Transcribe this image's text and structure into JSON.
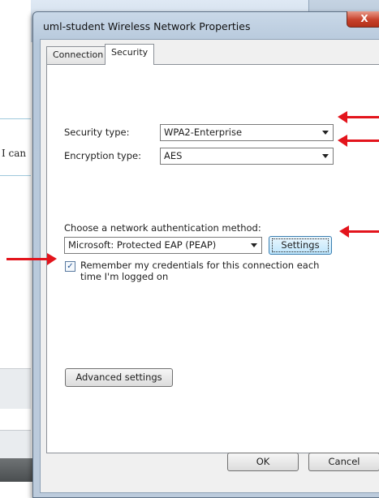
{
  "background": {
    "partial_text": "I can"
  },
  "window": {
    "title": "uml-student Wireless Network Properties",
    "close_label": "X"
  },
  "tabs": [
    {
      "label": "Connection"
    },
    {
      "label": "Security"
    }
  ],
  "security": {
    "security_type_label": "Security type:",
    "security_type_value": "WPA2-Enterprise",
    "encryption_type_label": "Encryption type:",
    "encryption_type_value": "AES",
    "auth_method_label": "Choose a network authentication method:",
    "auth_method_value": "Microsoft: Protected EAP (PEAP)",
    "settings_label": "Settings",
    "remember_label_line1": "Remember my credentials for this connection each",
    "remember_label_line2": "time I'm logged on",
    "remember_checked": true,
    "advanced_label": "Advanced settings"
  },
  "footer": {
    "ok_label": "OK",
    "cancel_label": "Cancel"
  },
  "colors": {
    "annotation_arrow": "#e3141c",
    "close_button": "#c7412b"
  },
  "icons": [
    "close-icon",
    "dropdown-arrow-icon",
    "checkmark-icon",
    "red-arrow-annotation"
  ]
}
